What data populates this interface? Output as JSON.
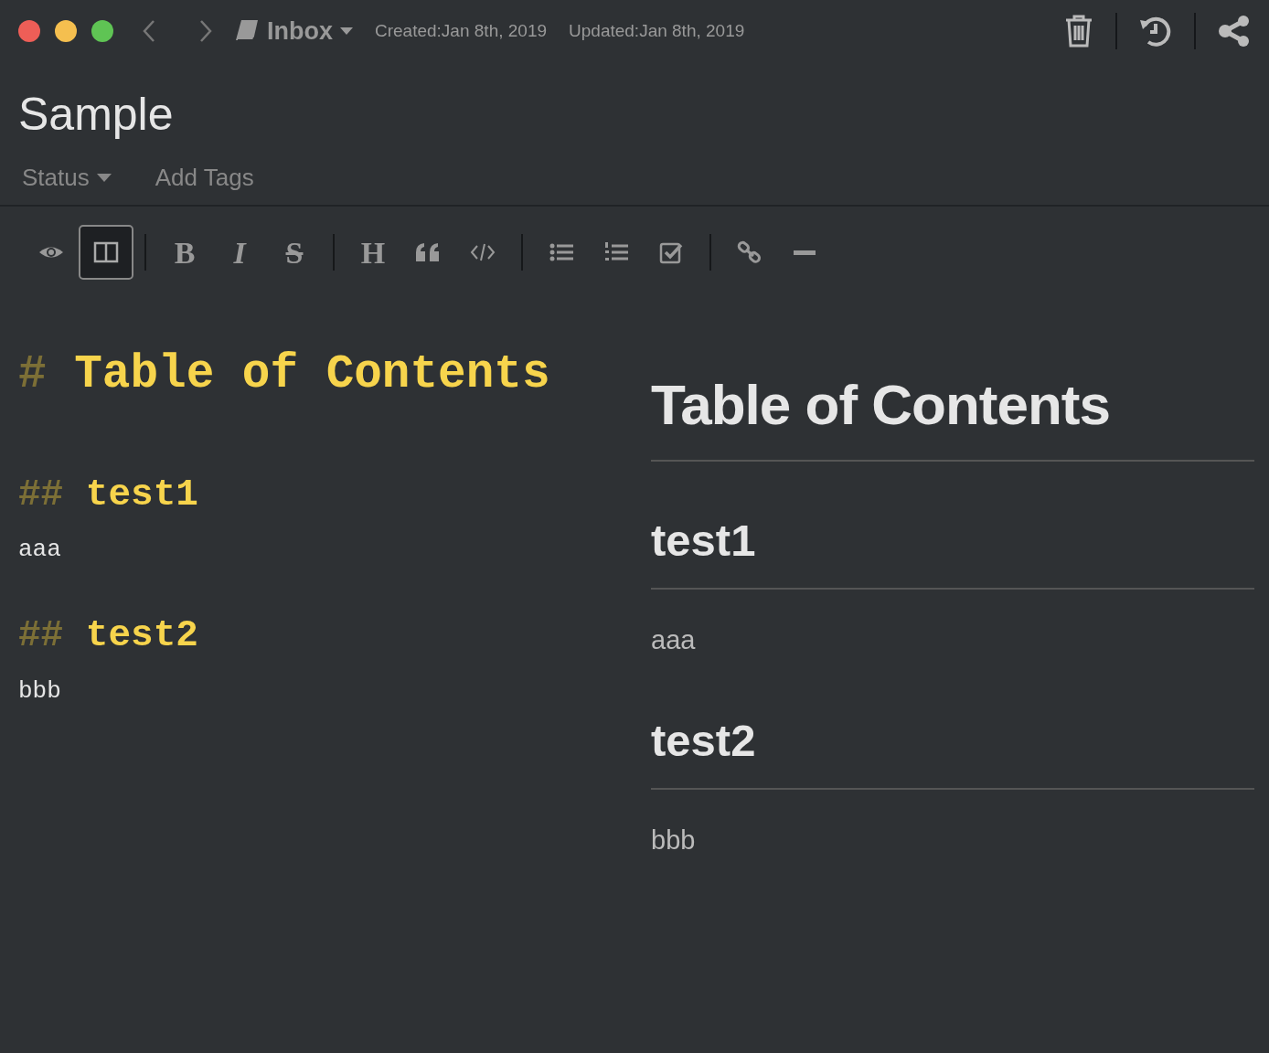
{
  "window": {
    "traffic_lights": [
      {
        "color": "#ee5e57"
      },
      {
        "color": "#f5bf4f"
      },
      {
        "color": "#5fc454"
      }
    ]
  },
  "header": {
    "notebook": "Inbox",
    "created": "Created:Jan 8th, 2019",
    "updated": "Updated:Jan 8th, 2019"
  },
  "note": {
    "title": "Sample",
    "status": "Status",
    "tags_placeholder": "Add Tags"
  },
  "toolbar": [
    [
      {
        "kind": "preview",
        "selected": false
      },
      {
        "kind": "split",
        "selected": true
      }
    ],
    [
      {
        "kind": "bold",
        "label": "B",
        "selected": false
      },
      {
        "kind": "italic",
        "label": "I",
        "selected": false
      },
      {
        "kind": "strike",
        "label": "S",
        "selected": false
      }
    ],
    [
      {
        "kind": "heading",
        "label": "H",
        "selected": false
      },
      {
        "kind": "quote",
        "selected": false
      },
      {
        "kind": "code",
        "selected": false
      }
    ],
    [
      {
        "kind": "bullets",
        "selected": false
      },
      {
        "kind": "numbers",
        "selected": false
      },
      {
        "kind": "checklist",
        "selected": false
      }
    ],
    [
      {
        "kind": "link",
        "selected": false
      },
      {
        "kind": "rule",
        "selected": false
      }
    ]
  ],
  "editor": [
    {
      "kind": "h1",
      "marker": "#",
      "text": "Table of Contents"
    },
    {
      "kind": "h2",
      "marker": "##",
      "text": "test1"
    },
    {
      "kind": "p",
      "text": "aaa"
    },
    {
      "kind": "h2",
      "marker": "##",
      "text": "test2"
    },
    {
      "kind": "p",
      "text": "bbb"
    }
  ],
  "preview": [
    {
      "kind": "h1",
      "text": "Table of Contents"
    },
    {
      "kind": "h2",
      "text": "test1"
    },
    {
      "kind": "p",
      "text": "aaa"
    },
    {
      "kind": "h2",
      "text": "test2"
    },
    {
      "kind": "p",
      "text": "bbb"
    }
  ]
}
